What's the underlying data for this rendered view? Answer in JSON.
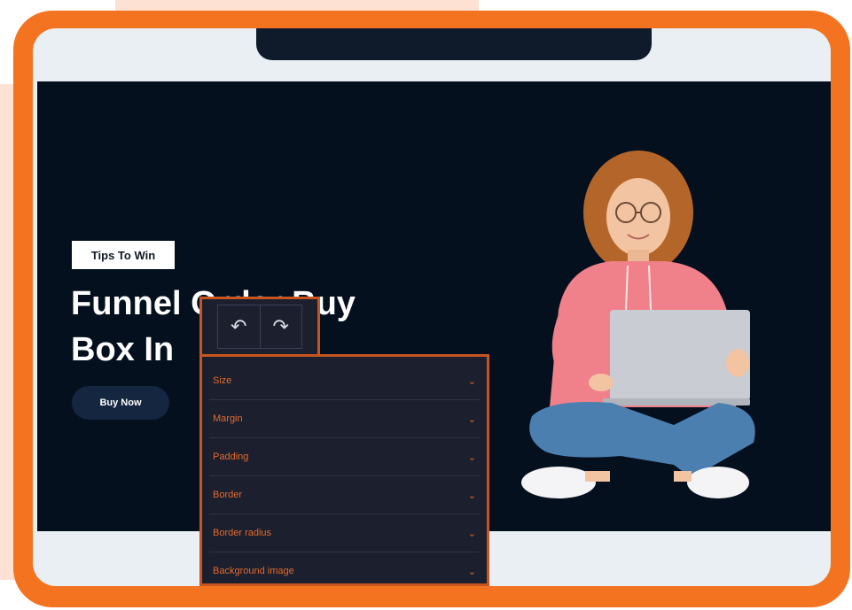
{
  "hero": {
    "tag": "Tips To Win",
    "headline": "Funnel Order Buy\nBox In",
    "button": "Buy Now"
  },
  "toolbar": {
    "undo_icon": "↶",
    "redo_icon": "↷"
  },
  "panel": {
    "chevron": "⌄",
    "items": [
      {
        "label": "Size"
      },
      {
        "label": "Margin"
      },
      {
        "label": "Padding"
      },
      {
        "label": "Border"
      },
      {
        "label": "Border radius"
      },
      {
        "label": "Background image"
      }
    ]
  },
  "colors": {
    "frame": "#f47320",
    "hero_bg": "#05101f",
    "panel_bg": "#1b1f2e",
    "panel_text": "#e46a2c",
    "hoodie": "#f0808a",
    "jeans": "#4a7fb0"
  }
}
